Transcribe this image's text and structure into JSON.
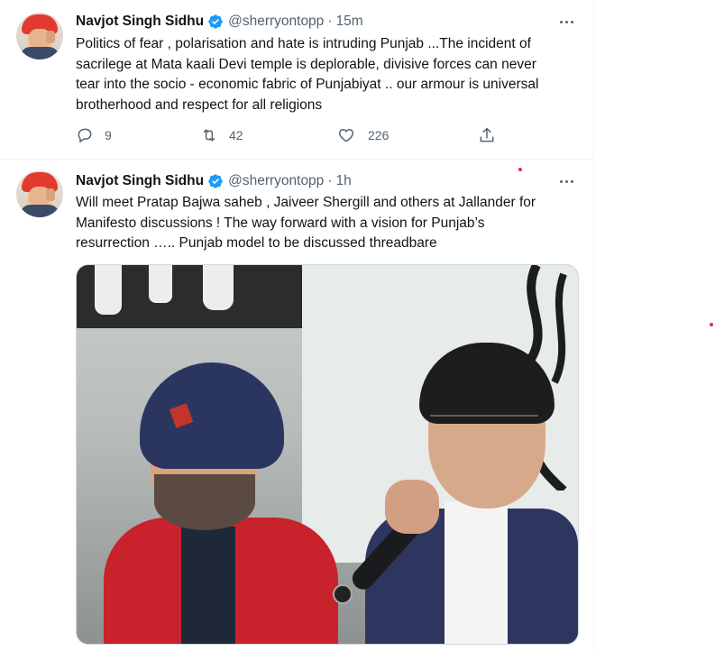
{
  "tweets": [
    {
      "author_name": "Navjot Singh Sidhu",
      "handle": "@sherryontopp",
      "separator": "·",
      "time": "15m",
      "text": "Politics of fear , polarisation and hate is intruding Punjab ...The incident of\nsacrilege at Mata kaali Devi temple is deplorable, divisive forces can never\ntear into the socio - economic fabric of  Punjabiyat .. our armour is universal\nbrotherhood and respect for all religions",
      "replies": "9",
      "retweets": "42",
      "likes": "226"
    },
    {
      "author_name": "Navjot Singh Sidhu",
      "handle": "@sherryontopp",
      "separator": "·",
      "time": "1h",
      "text": "Will meet Pratap Bajwa saheb , Jaiveer Shergill and others at Jallander for\nManifesto discussions ! The way forward with a vision for Punjab’s\nresurrection ….. Punjab model to be discussed threadbare"
    }
  ],
  "colors": {
    "verified": "#1d9bf0",
    "secondary_text": "#536471",
    "border": "#eff3f4"
  },
  "icons": [
    "verified-badge-icon",
    "more-icon",
    "reply-icon",
    "retweet-icon",
    "like-icon",
    "share-icon"
  ]
}
